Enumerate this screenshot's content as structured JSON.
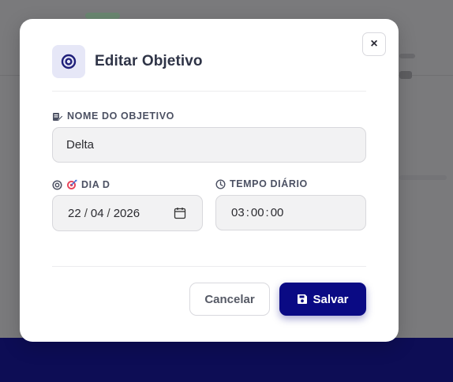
{
  "modal": {
    "title": "Editar Objetivo",
    "close_label": "×"
  },
  "form": {
    "name": {
      "label": "NOME DO OBJETIVO",
      "value": "Delta"
    },
    "dday": {
      "label": "DIA D",
      "day": "22",
      "month": "04",
      "year": "2026",
      "separator": "/"
    },
    "daily_time": {
      "label": "TEMPO DIÁRIO",
      "hours": "03",
      "minutes": "00",
      "seconds": "00",
      "separator": ":"
    }
  },
  "actions": {
    "cancel_label": "Cancelar",
    "save_label": "Salvar"
  },
  "colors": {
    "primary": "#0a0a84",
    "icon_accent": "#1f1f7a",
    "overlay_footer": "#0d0d55"
  },
  "icons": {
    "header": "target-icon",
    "name": "edit-note-icon",
    "dday": "target-icon",
    "dday_emoji": "dart-icon",
    "daily_time": "clock-icon",
    "calendar": "calendar-icon",
    "save": "floppy-disk-icon"
  }
}
